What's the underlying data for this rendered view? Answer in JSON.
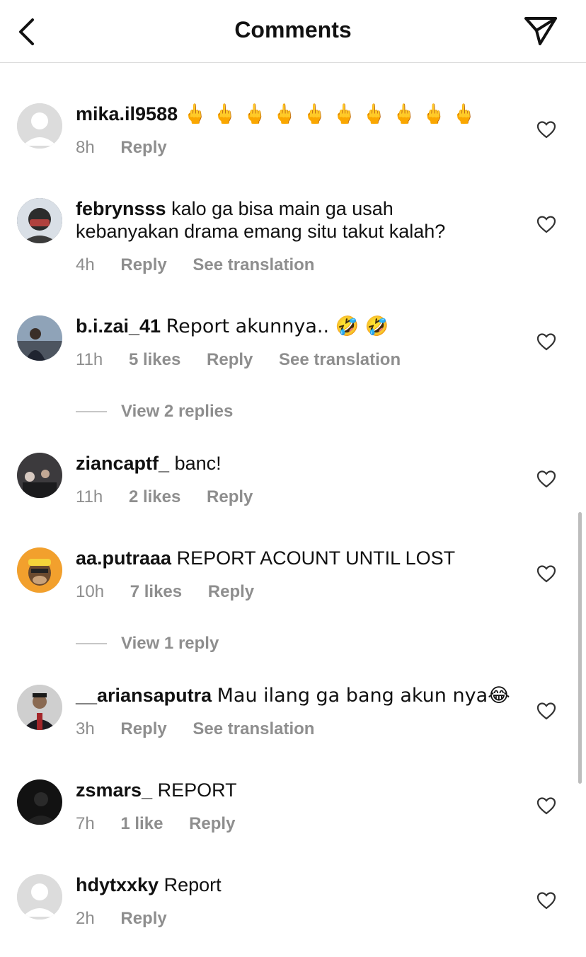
{
  "header": {
    "title": "Comments"
  },
  "comments": [
    {
      "username": "mika.il9588",
      "text": "🖕 🖕 🖕 🖕 🖕 🖕 🖕 🖕 🖕 🖕",
      "time": "8h",
      "likes": "",
      "reply": "Reply",
      "translation": ""
    },
    {
      "username": "febrynsss",
      "text": "kalo ga bisa main ga usah kebanyakan drama emang situ takut kalah?",
      "time": "4h",
      "likes": "",
      "reply": "Reply",
      "translation": "See translation"
    },
    {
      "username": "b.i.zai_41",
      "text": "Report akunnya.. 🤣 🤣",
      "time": "11h",
      "likes": "5 likes",
      "reply": "Reply",
      "translation": "See translation",
      "view_replies": "View 2 replies"
    },
    {
      "username": "ziancaptf_",
      "text": "banc!",
      "time": "11h",
      "likes": "2 likes",
      "reply": "Reply",
      "translation": ""
    },
    {
      "username": "aa.putraaa",
      "text": "REPORT ACOUNT UNTIL LOST",
      "time": "10h",
      "likes": "7 likes",
      "reply": "Reply",
      "translation": "",
      "view_replies": "View 1 reply"
    },
    {
      "username": "__ariansaputra",
      "text": "Mau ilang ga bang akun nya😂",
      "time": "3h",
      "likes": "",
      "reply": "Reply",
      "translation": "See translation"
    },
    {
      "username": "zsmars_",
      "text": "REPORT",
      "time": "7h",
      "likes": "1 like",
      "reply": "Reply",
      "translation": ""
    },
    {
      "username": "hdytxxky",
      "text": "Report",
      "time": "2h",
      "likes": "",
      "reply": "Reply",
      "translation": ""
    }
  ],
  "icons": {
    "back": "chevron-left-icon",
    "send": "paper-plane-icon",
    "like": "heart-outline-icon"
  },
  "colors": {
    "muted": "#8e8e8e",
    "text": "#111111",
    "divider": "#dbdbdb"
  }
}
